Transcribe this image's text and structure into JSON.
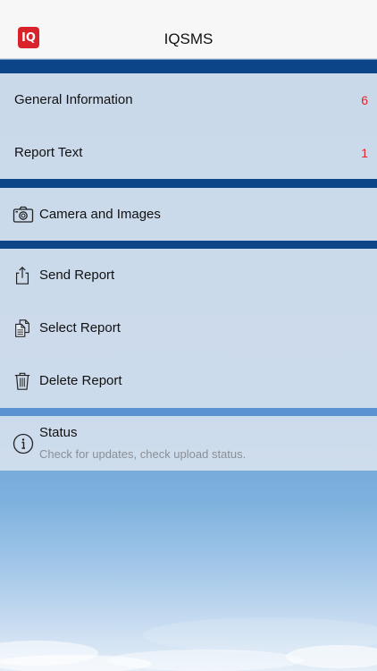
{
  "header": {
    "app_logo_text": "IQ",
    "title": "IQSMS"
  },
  "report_section": {
    "items": [
      {
        "label": "General Information",
        "count": "6"
      },
      {
        "label": "Report Text",
        "count": "1"
      }
    ]
  },
  "media_section": {
    "camera_label": "Camera and Images",
    "camera_icon": "camera-icon"
  },
  "actions_section": {
    "items": [
      {
        "label": "Send Report",
        "icon": "share-icon"
      },
      {
        "label": "Select Report",
        "icon": "documents-icon"
      },
      {
        "label": "Delete Report",
        "icon": "trash-icon"
      }
    ]
  },
  "status_section": {
    "title": "Status",
    "subtitle": "Check for updates, check upload status.",
    "icon": "info-icon"
  },
  "colors": {
    "separator": "#0d4589",
    "count_badge": "#e3242b",
    "logo": "#d8232a"
  }
}
